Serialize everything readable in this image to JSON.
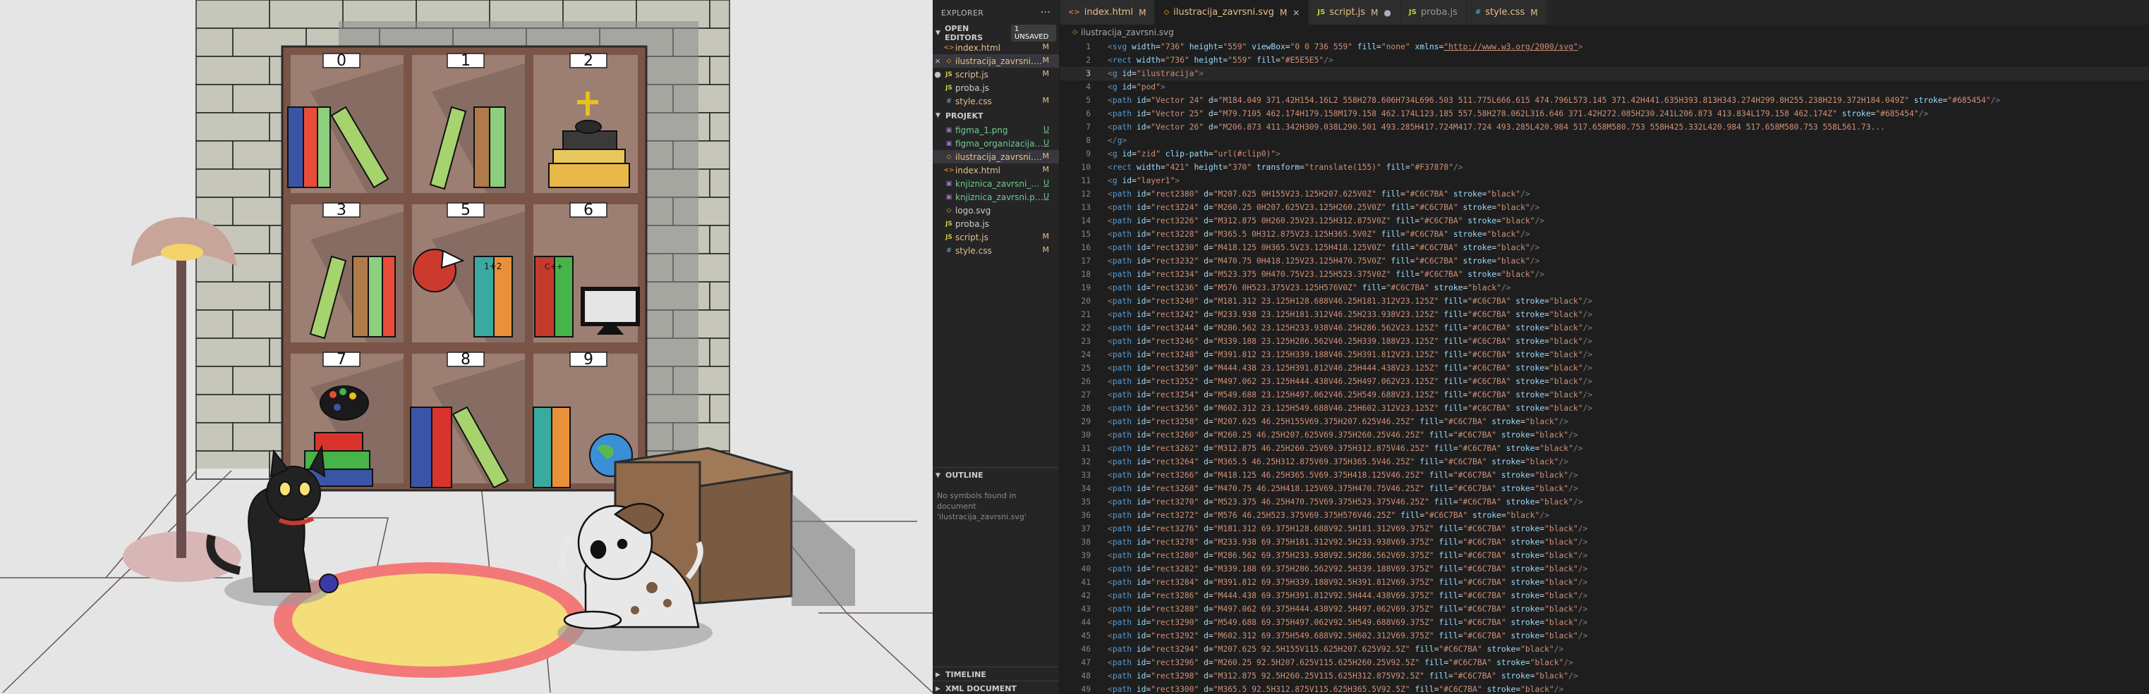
{
  "illustration": {
    "shelf_numbers": [
      "0",
      "1",
      "2",
      "3",
      "5",
      "6",
      "7",
      "8",
      "9"
    ]
  },
  "explorer": {
    "title": "EXPLORER",
    "more": "···",
    "open_editors": {
      "label": "OPEN EDITORS",
      "badge": "1 UNSAVED",
      "items": [
        {
          "marker": "",
          "icon": "<>",
          "name": "index.html",
          "status": "M"
        },
        {
          "marker": "×",
          "icon": "◇",
          "name": "ilustracija_zavrsni.svg",
          "status": "M"
        },
        {
          "marker": "●",
          "icon": "JS",
          "name": "script.js",
          "status": "M"
        },
        {
          "marker": "",
          "icon": "JS",
          "name": "proba.js",
          "status": ""
        },
        {
          "marker": "",
          "icon": "#",
          "name": "style.css",
          "status": "M"
        }
      ]
    },
    "project": {
      "label": "PROJEKT",
      "items": [
        {
          "icon": "▣",
          "name": "figma_1.png",
          "status": "U"
        },
        {
          "icon": "▣",
          "name": "figma_organizacija.png",
          "status": "U"
        },
        {
          "icon": "◇",
          "name": "ilustracija_zavrsni.svg",
          "status": "M"
        },
        {
          "icon": "<>",
          "name": "index.html",
          "status": "M"
        },
        {
          "icon": "▣",
          "name": "knjiznica_zavrsni_figma.png",
          "status": "U"
        },
        {
          "icon": "▣",
          "name": "knjiznica_zavrsni.png",
          "status": "U"
        },
        {
          "icon": "◇",
          "name": "logo.svg",
          "status": ""
        },
        {
          "icon": "JS",
          "name": "proba.js",
          "status": ""
        },
        {
          "icon": "JS",
          "name": "script.js",
          "status": "M"
        },
        {
          "icon": "#",
          "name": "style.css",
          "status": "M"
        }
      ]
    },
    "outline": {
      "label": "OUTLINE",
      "message": "No symbols found in document 'ilustracija_zavrsni.svg'"
    },
    "timeline": "TIMELINE",
    "xml_document": "XML DOCUMENT"
  },
  "tabs": [
    {
      "icon": "<>",
      "label": "index.html",
      "status": "M",
      "active": false
    },
    {
      "icon": "◇",
      "label": "ilustracija_zavrsni.svg",
      "status": "M",
      "active": true
    },
    {
      "icon": "JS",
      "label": "script.js",
      "status": "M",
      "active": false
    },
    {
      "icon": "JS",
      "label": "proba.js",
      "status": "",
      "active": false
    },
    {
      "icon": "#",
      "label": "style.css",
      "status": "M",
      "active": false
    }
  ],
  "breadcrumb": "ilustracija_zavrsni.svg",
  "editor": {
    "current_line": 3,
    "lines": [
      {
        "n": "1",
        "text": "<svg width=\"736\" height=\"559\" viewBox=\"0 0 736 559\" fill=\"none\" xmlns=\"http://www.w3.org/2000/svg\">"
      },
      {
        "n": "2",
        "text": "<rect width=\"736\" height=\"559\" fill=\"#E5E5E5\"/>"
      },
      {
        "n": "3",
        "text": "<g id=\"ilustracija\">"
      },
      {
        "n": "4",
        "text": "<g id=\"pod\">"
      },
      {
        "n": "5",
        "text": "<path id=\"Vector 24\" d=\"M184.049 371.42H154.16L2 558H278.606H734L696.503 511.775L666.615 474.796L573.145 371.42H441.635H393.813H343.274H299.8H255.238H219.372H184.049Z\" stroke=\"#685454\"/>"
      },
      {
        "n": "6",
        "text": "<path id=\"Vector 25\" d=\"M79.7105 462.174H179.158M179.158 462.174L123.185 557.58H278.062L316.646 371.42H272.085H230.241L206.873 413.834L179.158 462.174Z\" stroke=\"#685454\"/>"
      },
      {
        "n": "7",
        "text": "<path id=\"Vector 26\" d=\"M206.873 411.342H309.038L290.501 493.285H417.724M417.724 493.285L420.984 517.658M580.753 558H425.332L420.984 517.658M580.753 558L561.73..."
      },
      {
        "n": "8",
        "text": "</g>"
      },
      {
        "n": "9",
        "text": "<g id=\"zid\" clip-path=\"url(#clip0)\">"
      },
      {
        "n": "10",
        "text": "<rect width=\"421\" height=\"370\" transform=\"translate(155)\" fill=\"#F37878\"/>"
      },
      {
        "n": "11",
        "text": "<g id=\"layer1\">"
      },
      {
        "n": "12",
        "text": "<path id=\"rect2380\" d=\"M207.625 0H155V23.125H207.625V0Z\" fill=\"#C6C7BA\" stroke=\"black\"/>"
      },
      {
        "n": "13",
        "text": "<path id=\"rect3224\" d=\"M260.25 0H207.625V23.125H260.25V0Z\" fill=\"#C6C7BA\" stroke=\"black\"/>"
      },
      {
        "n": "14",
        "text": "<path id=\"rect3226\" d=\"M312.875 0H260.25V23.125H312.875V0Z\" fill=\"#C6C7BA\" stroke=\"black\"/>"
      },
      {
        "n": "15",
        "text": "<path id=\"rect3228\" d=\"M365.5 0H312.875V23.125H365.5V0Z\" fill=\"#C6C7BA\" stroke=\"black\"/>"
      },
      {
        "n": "16",
        "text": "<path id=\"rect3230\" d=\"M418.125 0H365.5V23.125H418.125V0Z\" fill=\"#C6C7BA\" stroke=\"black\"/>"
      },
      {
        "n": "17",
        "text": "<path id=\"rect3232\" d=\"M470.75 0H418.125V23.125H470.75V0Z\" fill=\"#C6C7BA\" stroke=\"black\"/>"
      },
      {
        "n": "18",
        "text": "<path id=\"rect3234\" d=\"M523.375 0H470.75V23.125H523.375V0Z\" fill=\"#C6C7BA\" stroke=\"black\"/>"
      },
      {
        "n": "19",
        "text": "<path id=\"rect3236\" d=\"M576 0H523.375V23.125H576V0Z\" fill=\"#C6C7BA\" stroke=\"black\"/>"
      },
      {
        "n": "20",
        "text": "<path id=\"rect3240\" d=\"M181.312 23.125H128.688V46.25H181.312V23.125Z\" fill=\"#C6C7BA\" stroke=\"black\"/>"
      },
      {
        "n": "21",
        "text": "<path id=\"rect3242\" d=\"M233.938 23.125H181.312V46.25H233.938V23.125Z\" fill=\"#C6C7BA\" stroke=\"black\"/>"
      },
      {
        "n": "22",
        "text": "<path id=\"rect3244\" d=\"M286.562 23.125H233.938V46.25H286.562V23.125Z\" fill=\"#C6C7BA\" stroke=\"black\"/>"
      },
      {
        "n": "23",
        "text": "<path id=\"rect3246\" d=\"M339.188 23.125H286.562V46.25H339.188V23.125Z\" fill=\"#C6C7BA\" stroke=\"black\"/>"
      },
      {
        "n": "24",
        "text": "<path id=\"rect3248\" d=\"M391.812 23.125H339.188V46.25H391.812V23.125Z\" fill=\"#C6C7BA\" stroke=\"black\"/>"
      },
      {
        "n": "25",
        "text": "<path id=\"rect3250\" d=\"M444.438 23.125H391.812V46.25H444.438V23.125Z\" fill=\"#C6C7BA\" stroke=\"black\"/>"
      },
      {
        "n": "26",
        "text": "<path id=\"rect3252\" d=\"M497.062 23.125H444.438V46.25H497.062V23.125Z\" fill=\"#C6C7BA\" stroke=\"black\"/>"
      },
      {
        "n": "27",
        "text": "<path id=\"rect3254\" d=\"M549.688 23.125H497.062V46.25H549.688V23.125Z\" fill=\"#C6C7BA\" stroke=\"black\"/>"
      },
      {
        "n": "28",
        "text": "<path id=\"rect3256\" d=\"M602.312 23.125H549.688V46.25H602.312V23.125Z\" fill=\"#C6C7BA\" stroke=\"black\"/>"
      },
      {
        "n": "29",
        "text": "<path id=\"rect3258\" d=\"M207.625 46.25H155V69.375H207.625V46.25Z\" fill=\"#C6C7BA\" stroke=\"black\"/>"
      },
      {
        "n": "30",
        "text": "<path id=\"rect3260\" d=\"M260.25 46.25H207.625V69.375H260.25V46.25Z\" fill=\"#C6C7BA\" stroke=\"black\"/>"
      },
      {
        "n": "31",
        "text": "<path id=\"rect3262\" d=\"M312.875 46.25H260.25V69.375H312.875V46.25Z\" fill=\"#C6C7BA\" stroke=\"black\"/>"
      },
      {
        "n": "32",
        "text": "<path id=\"rect3264\" d=\"M365.5 46.25H312.875V69.375H365.5V46.25Z\" fill=\"#C6C7BA\" stroke=\"black\"/>"
      },
      {
        "n": "33",
        "text": "<path id=\"rect3266\" d=\"M418.125 46.25H365.5V69.375H418.125V46.25Z\" fill=\"#C6C7BA\" stroke=\"black\"/>"
      },
      {
        "n": "34",
        "text": "<path id=\"rect3268\" d=\"M470.75 46.25H418.125V69.375H470.75V46.25Z\" fill=\"#C6C7BA\" stroke=\"black\"/>"
      },
      {
        "n": "35",
        "text": "<path id=\"rect3270\" d=\"M523.375 46.25H470.75V69.375H523.375V46.25Z\" fill=\"#C6C7BA\" stroke=\"black\"/>"
      },
      {
        "n": "36",
        "text": "<path id=\"rect3272\" d=\"M576 46.25H523.375V69.375H576V46.25Z\" fill=\"#C6C7BA\" stroke=\"black\"/>"
      },
      {
        "n": "37",
        "text": "<path id=\"rect3276\" d=\"M181.312 69.375H128.688V92.5H181.312V69.375Z\" fill=\"#C6C7BA\" stroke=\"black\"/>"
      },
      {
        "n": "38",
        "text": "<path id=\"rect3278\" d=\"M233.938 69.375H181.312V92.5H233.938V69.375Z\" fill=\"#C6C7BA\" stroke=\"black\"/>"
      },
      {
        "n": "39",
        "text": "<path id=\"rect3280\" d=\"M286.562 69.375H233.938V92.5H286.562V69.375Z\" fill=\"#C6C7BA\" stroke=\"black\"/>"
      },
      {
        "n": "40",
        "text": "<path id=\"rect3282\" d=\"M339.188 69.375H286.562V92.5H339.188V69.375Z\" fill=\"#C6C7BA\" stroke=\"black\"/>"
      },
      {
        "n": "41",
        "text": "<path id=\"rect3284\" d=\"M391.812 69.375H339.188V92.5H391.812V69.375Z\" fill=\"#C6C7BA\" stroke=\"black\"/>"
      },
      {
        "n": "42",
        "text": "<path id=\"rect3286\" d=\"M444.438 69.375H391.812V92.5H444.438V69.375Z\" fill=\"#C6C7BA\" stroke=\"black\"/>"
      },
      {
        "n": "43",
        "text": "<path id=\"rect3288\" d=\"M497.062 69.375H444.438V92.5H497.062V69.375Z\" fill=\"#C6C7BA\" stroke=\"black\"/>"
      },
      {
        "n": "44",
        "text": "<path id=\"rect3290\" d=\"M549.688 69.375H497.062V92.5H549.688V69.375Z\" fill=\"#C6C7BA\" stroke=\"black\"/>"
      },
      {
        "n": "45",
        "text": "<path id=\"rect3292\" d=\"M602.312 69.375H549.688V92.5H602.312V69.375Z\" fill=\"#C6C7BA\" stroke=\"black\"/>"
      },
      {
        "n": "46",
        "text": "<path id=\"rect3294\" d=\"M207.625 92.5H155V115.625H207.625V92.5Z\" fill=\"#C6C7BA\" stroke=\"black\"/>"
      },
      {
        "n": "47",
        "text": "<path id=\"rect3296\" d=\"M260.25 92.5H207.625V115.625H260.25V92.5Z\" fill=\"#C6C7BA\" stroke=\"black\"/>"
      },
      {
        "n": "48",
        "text": "<path id=\"rect3298\" d=\"M312.875 92.5H260.25V115.625H312.875V92.5Z\" fill=\"#C6C7BA\" stroke=\"black\"/>"
      },
      {
        "n": "49",
        "text": "<path id=\"rect3300\" d=\"M365.5 92.5H312.875V115.625H365.5V92.5Z\" fill=\"#C6C7BA\" stroke=\"black\"/>"
      }
    ]
  },
  "colors": {
    "editor_bg": "#1e1e1e",
    "sidebar_bg": "#252526",
    "modified": "#e2c08d",
    "untracked": "#73c991",
    "wall": "#e5e5e5",
    "brick": "#c6c7ba",
    "shelf": "#7a5547",
    "rug_outer": "#f37878",
    "rug_inner": "#f4de7a"
  }
}
